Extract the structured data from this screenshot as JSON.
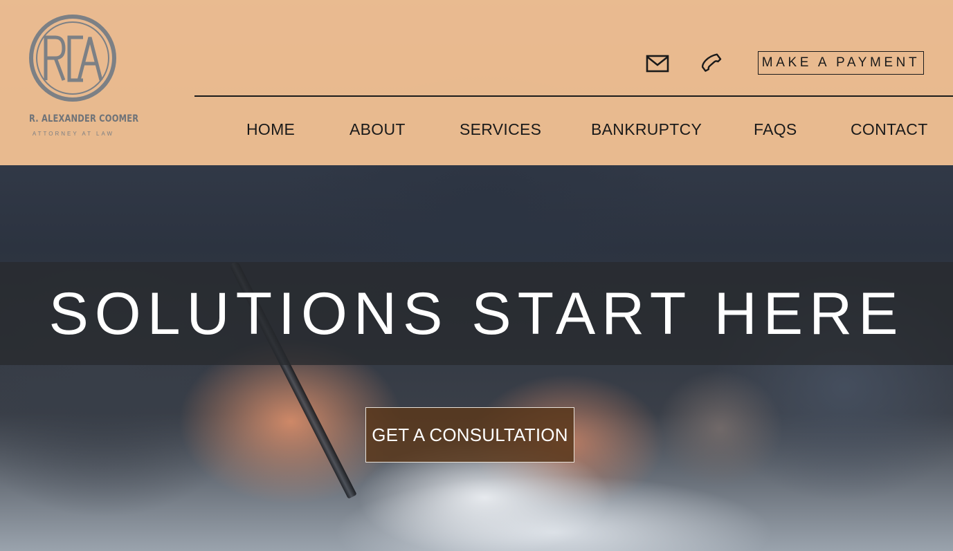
{
  "header": {
    "logo": {
      "monogram": "RCA",
      "name": "R. ALEXANDER COOMER",
      "subtitle": "ATTORNEY AT LAW"
    },
    "utility": {
      "email_icon": "email-icon",
      "phone_icon": "phone-icon",
      "payment_label": "MAKE A PAYMENT"
    },
    "nav": {
      "items": [
        {
          "label": "HOME"
        },
        {
          "label": "ABOUT"
        },
        {
          "label": "SERVICES"
        },
        {
          "label": "BANKRUPTCY"
        },
        {
          "label": "FAQS"
        },
        {
          "label": "CONTACT"
        }
      ]
    }
  },
  "hero": {
    "headline": "SOLUTIONS START HERE",
    "cta_label": "GET A CONSULTATION"
  },
  "colors": {
    "header_bg": "#f6c494",
    "logo_gray": "#6f7378",
    "text_dark": "#1a1a1a",
    "headline_band": "#282a2e",
    "cta_bg": "#5a381c"
  }
}
